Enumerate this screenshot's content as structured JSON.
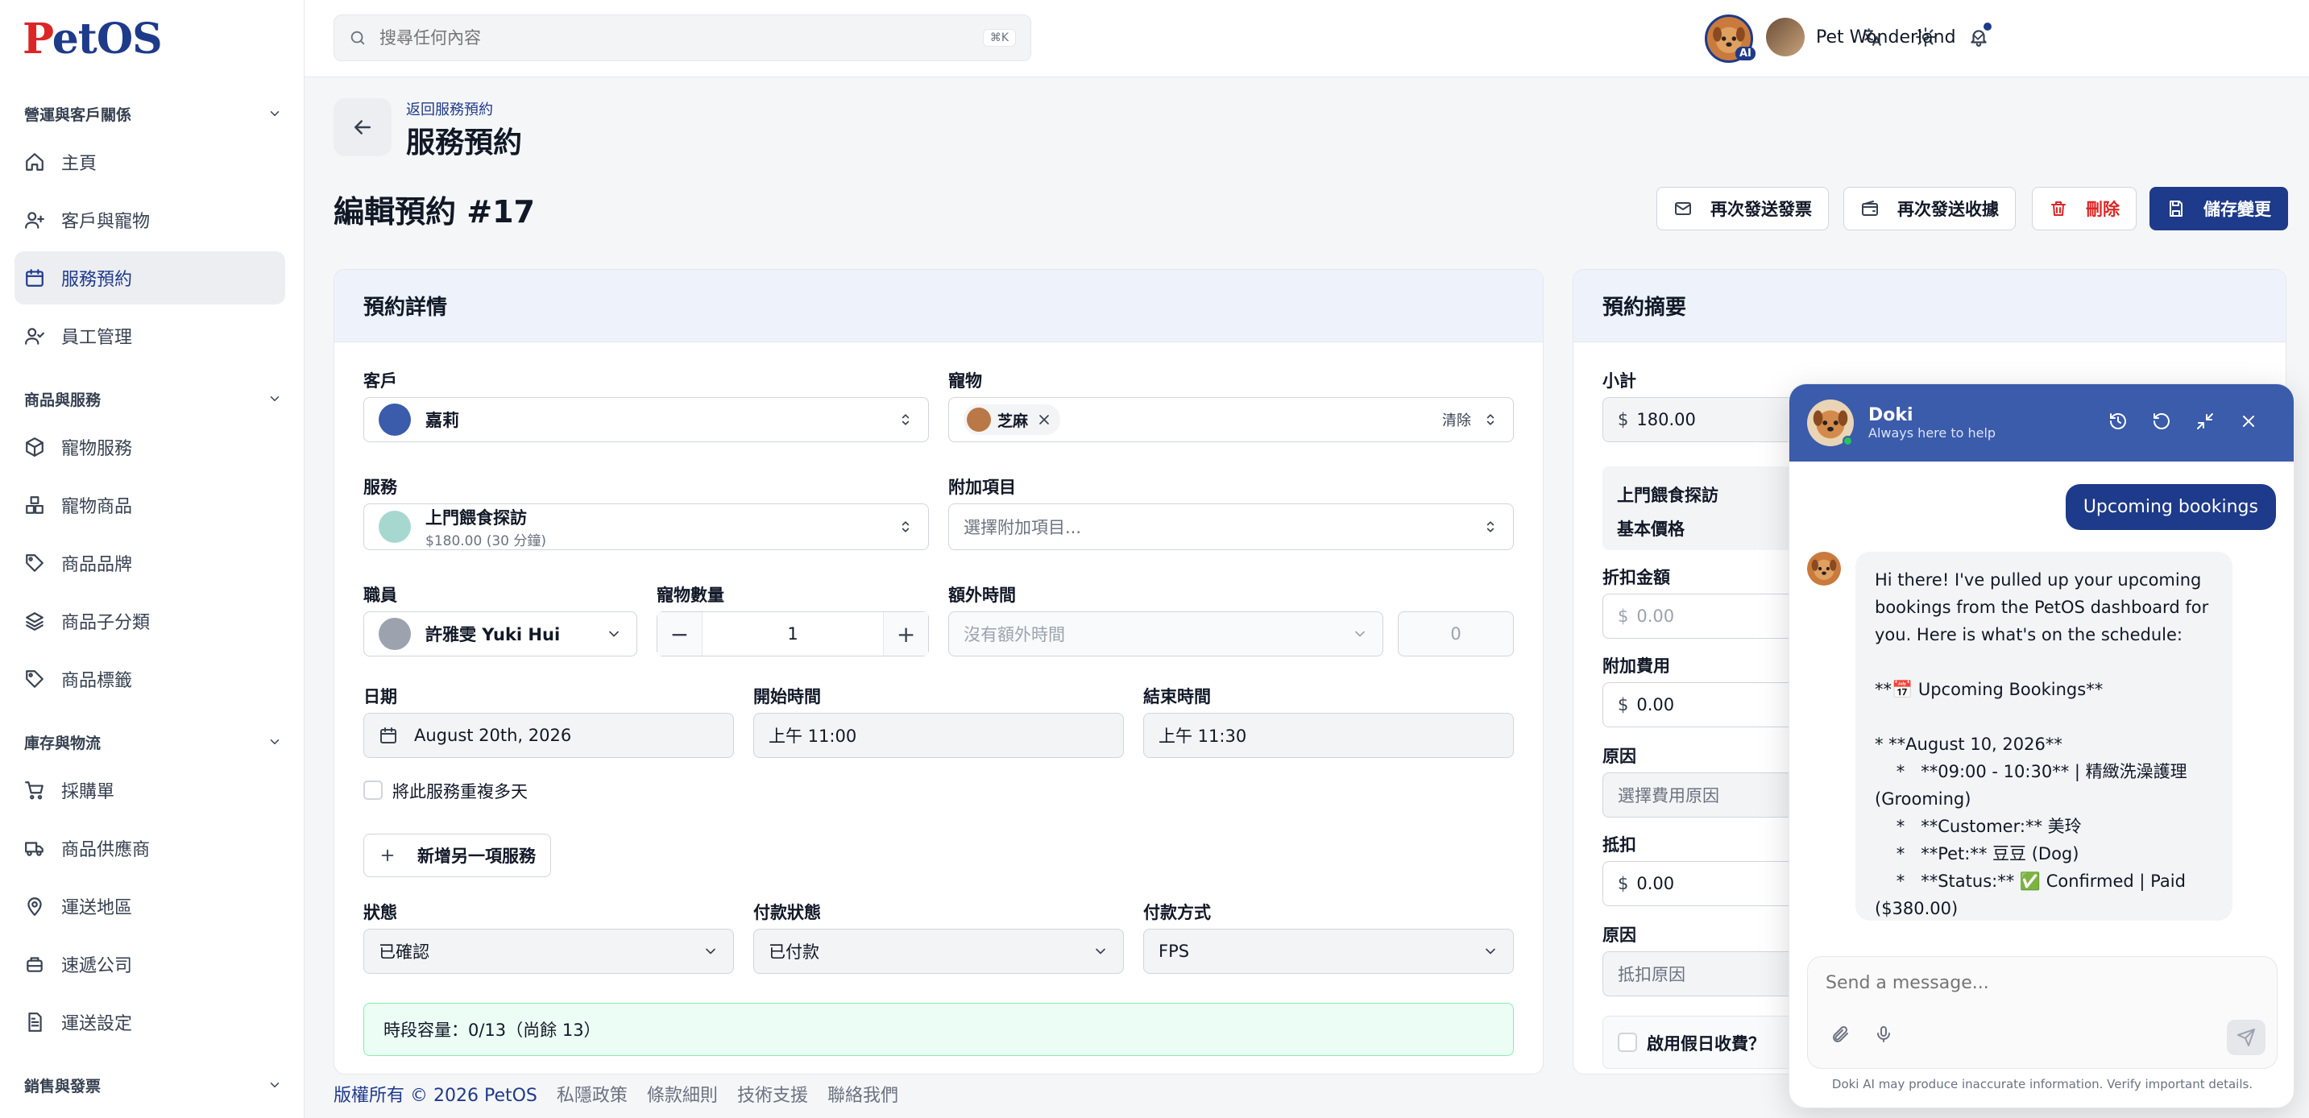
{
  "app": {
    "logo_p": "P",
    "logo_rest": "etOS"
  },
  "search": {
    "placeholder": "搜尋任何內容",
    "shortcut": "⌘K"
  },
  "topbar": {
    "ai_badge": "AI",
    "user_name": "Pet Wonderland"
  },
  "sidebar": {
    "sections": [
      {
        "title": "營運與客戶關係",
        "items": [
          "主頁",
          "客戶與寵物",
          "服務預約",
          "員工管理"
        ]
      },
      {
        "title": "商品與服務",
        "items": [
          "寵物服務",
          "寵物商品",
          "商品品牌",
          "商品子分類",
          "商品標籤"
        ]
      },
      {
        "title": "庫存與物流",
        "items": [
          "採購單",
          "商品供應商",
          "運送地區",
          "速遞公司",
          "運送設定"
        ]
      },
      {
        "title": "銷售與發票",
        "items": []
      }
    ],
    "active_item": "服務預約"
  },
  "header": {
    "breadcrumb": "返回服務預約",
    "page_title": "服務預約",
    "edit_title": "編輯預約 #17",
    "actions": {
      "resend_invoice": "再次發送發票",
      "resend_receipt": "再次發送收據",
      "delete": "刪除",
      "save": "儲存變更"
    }
  },
  "details": {
    "title": "預約詳情",
    "customer": {
      "label": "客戶",
      "value": "嘉莉"
    },
    "pet": {
      "label": "寵物",
      "chip": "芝麻",
      "clear": "清除"
    },
    "service": {
      "label": "服務",
      "name": "上門餵食探訪",
      "sub": "$180.00 (30 分鐘)"
    },
    "addon": {
      "label": "附加項目",
      "placeholder": "選擇附加項目..."
    },
    "staff": {
      "label": "職員",
      "value": "許雅雯 Yuki Hui"
    },
    "pet_count": {
      "label": "寵物數量",
      "value": "1",
      "minus": "−",
      "plus": "+"
    },
    "extra_time": {
      "label": "額外時間",
      "placeholder": "沒有額外時間",
      "value": "0"
    },
    "date": {
      "label": "日期",
      "value": "August 20th, 2026"
    },
    "start_time": {
      "label": "開始時間",
      "value": "上午 11:00"
    },
    "end_time": {
      "label": "結束時間",
      "value": "上午 11:30"
    },
    "repeat_label": "將此服務重複多天",
    "add_service": "新增另一項服務",
    "status": {
      "label": "狀態",
      "value": "已確認"
    },
    "payment_status": {
      "label": "付款狀態",
      "value": "已付款"
    },
    "payment_method": {
      "label": "付款方式",
      "value": "FPS"
    },
    "capacity": "時段容量：0/13（尚餘 13）"
  },
  "summary": {
    "title": "預約摘要",
    "subtotal": {
      "label": "小計",
      "currency": "$",
      "value": "180.00"
    },
    "service_name": "上門餵食探訪",
    "base_price": "基本價格",
    "discount": {
      "label": "折扣金額",
      "currency": "$",
      "placeholder": "0.00"
    },
    "extra_fee": {
      "label": "附加費用",
      "currency": "$",
      "value": "0.00"
    },
    "fee_reason": {
      "label": "原因",
      "placeholder": "選擇費用原因"
    },
    "deduction": {
      "label": "抵扣",
      "currency": "$",
      "value": "0.00"
    },
    "deduction_reason": {
      "label": "原因",
      "placeholder": "抵扣原因"
    },
    "holiday_label": "啟用假日收費？"
  },
  "footer": {
    "copyright": "版權所有 © 2026 PetOS",
    "links": [
      "私隱政策",
      "條款細則",
      "技術支援",
      "聯絡我們"
    ]
  },
  "chat": {
    "name": "Doki",
    "subtitle": "Always here to help",
    "user_message": "Upcoming bookings",
    "bot_lines": [
      "Hi there! I've pulled up your upcoming",
      "bookings from the PetOS dashboard for",
      "you. Here is what's on the schedule:",
      "",
      "**📅 Upcoming Bookings**",
      "",
      "*   **August 10, 2026**",
      "    *   **09:00 - 10:30** | 精緻洗澡護理",
      "(Grooming)",
      "    *   **Customer:** 美玲",
      "    *   **Pet:** 豆豆 (Dog)",
      "    *   **Status:** ✅ Confirmed | Paid",
      "($380.00)"
    ],
    "input_placeholder": "Send a message...",
    "disclaimer": "Doki AI may produce inaccurate information. Verify important details."
  },
  "colors": {
    "brand": "#1e3a8a",
    "brand_red": "#dc2626",
    "chat_header": "#3b5bab",
    "capacity_bg": "#ecfdf5"
  }
}
